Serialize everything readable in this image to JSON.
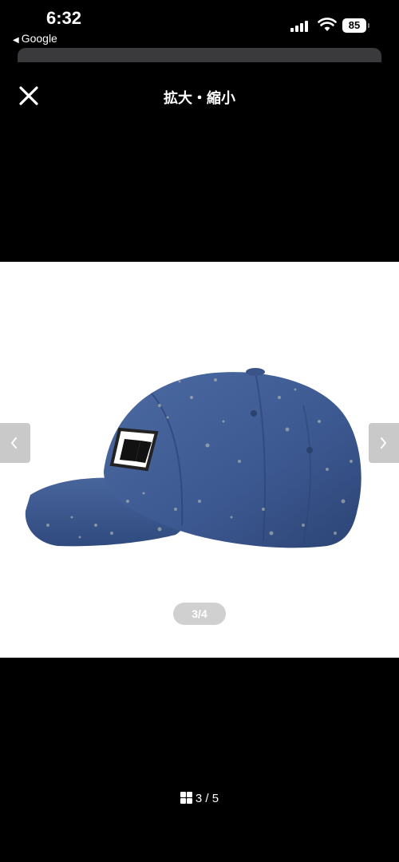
{
  "status_bar": {
    "time": "6:32",
    "back_app": "Google",
    "back_icon": "triangle-left",
    "battery": "85"
  },
  "header": {
    "title": "拡大・縮小",
    "close_icon": "close-x"
  },
  "viewer": {
    "image_counter": "3/4",
    "prev_icon": "chevron-left",
    "next_icon": "chevron-right",
    "image_subject": "blue baseball cap side view"
  },
  "footer": {
    "gallery_icon": "grid-icon",
    "gallery_counter": "3 / 5"
  },
  "colors": {
    "background": "#000000",
    "image_bg": "#ffffff",
    "nav_button": "#c9c9c9",
    "counter_pill": "#d0d0d0",
    "cap_blue": "#3e5b92"
  }
}
